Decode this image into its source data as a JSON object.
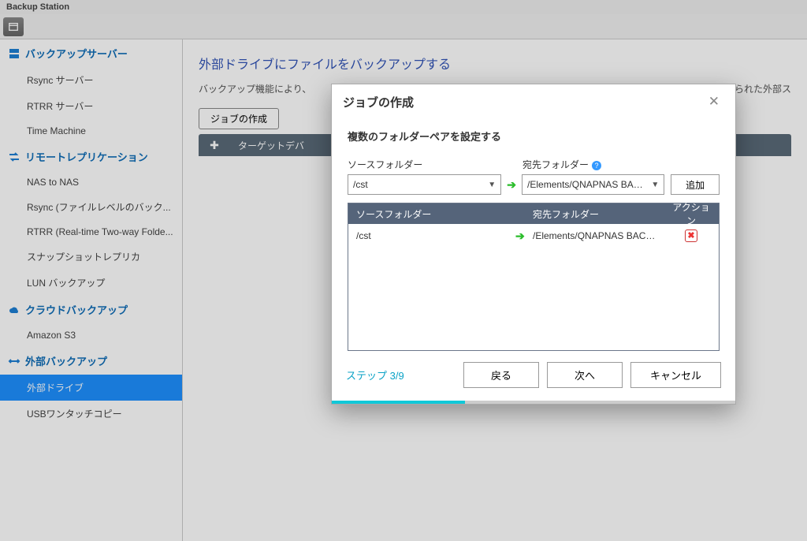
{
  "app_title": "Backup Station",
  "sidebar": {
    "groups": [
      {
        "icon": "server",
        "label": "バックアップサーバー",
        "items": [
          "Rsync サーバー",
          "RTRR サーバー",
          "Time Machine"
        ]
      },
      {
        "icon": "transfer",
        "label": "リモートレプリケーション",
        "items": [
          "NAS to NAS",
          "Rsync (ファイルレベルのバック...",
          "RTRR (Real-time Two-way Folde...",
          "スナップショットレプリカ",
          "LUN バックアップ"
        ]
      },
      {
        "icon": "cloud",
        "label": "クラウドバックアップ",
        "items": [
          "Amazon S3"
        ]
      },
      {
        "icon": "swap",
        "label": "外部バックアップ",
        "items": [
          "外部ドライブ",
          "USBワンタッチコピー"
        ]
      }
    ],
    "active": "外部ドライブ"
  },
  "page": {
    "title": "外部ドライブにファイルをバックアップする",
    "desc_left": "バックアップ機能により、",
    "desc_right": "して、特定のディスブが割り当てられた外部ス",
    "create_job_btn": "ジョブの作成",
    "grid_th1": "ターゲットデバ"
  },
  "modal": {
    "title": "ジョブの作成",
    "step_title": "複数のフォルダーペアを設定する",
    "src_label": "ソースフォルダー",
    "dest_label": "宛先フォルダー",
    "src_value": "/cst",
    "dest_value": "/Elements/QNAPNAS BACKUP",
    "add_btn": "追加",
    "th_src": "ソースフォルダー",
    "th_dest": "宛先フォルダー",
    "th_action": "アクション",
    "rows": [
      {
        "src": "/cst",
        "dest": "/Elements/QNAPNAS BACKUP"
      }
    ],
    "step_indicator": "ステップ 3/9",
    "btn_back": "戻る",
    "btn_next": "次へ",
    "btn_cancel": "キャンセル"
  }
}
